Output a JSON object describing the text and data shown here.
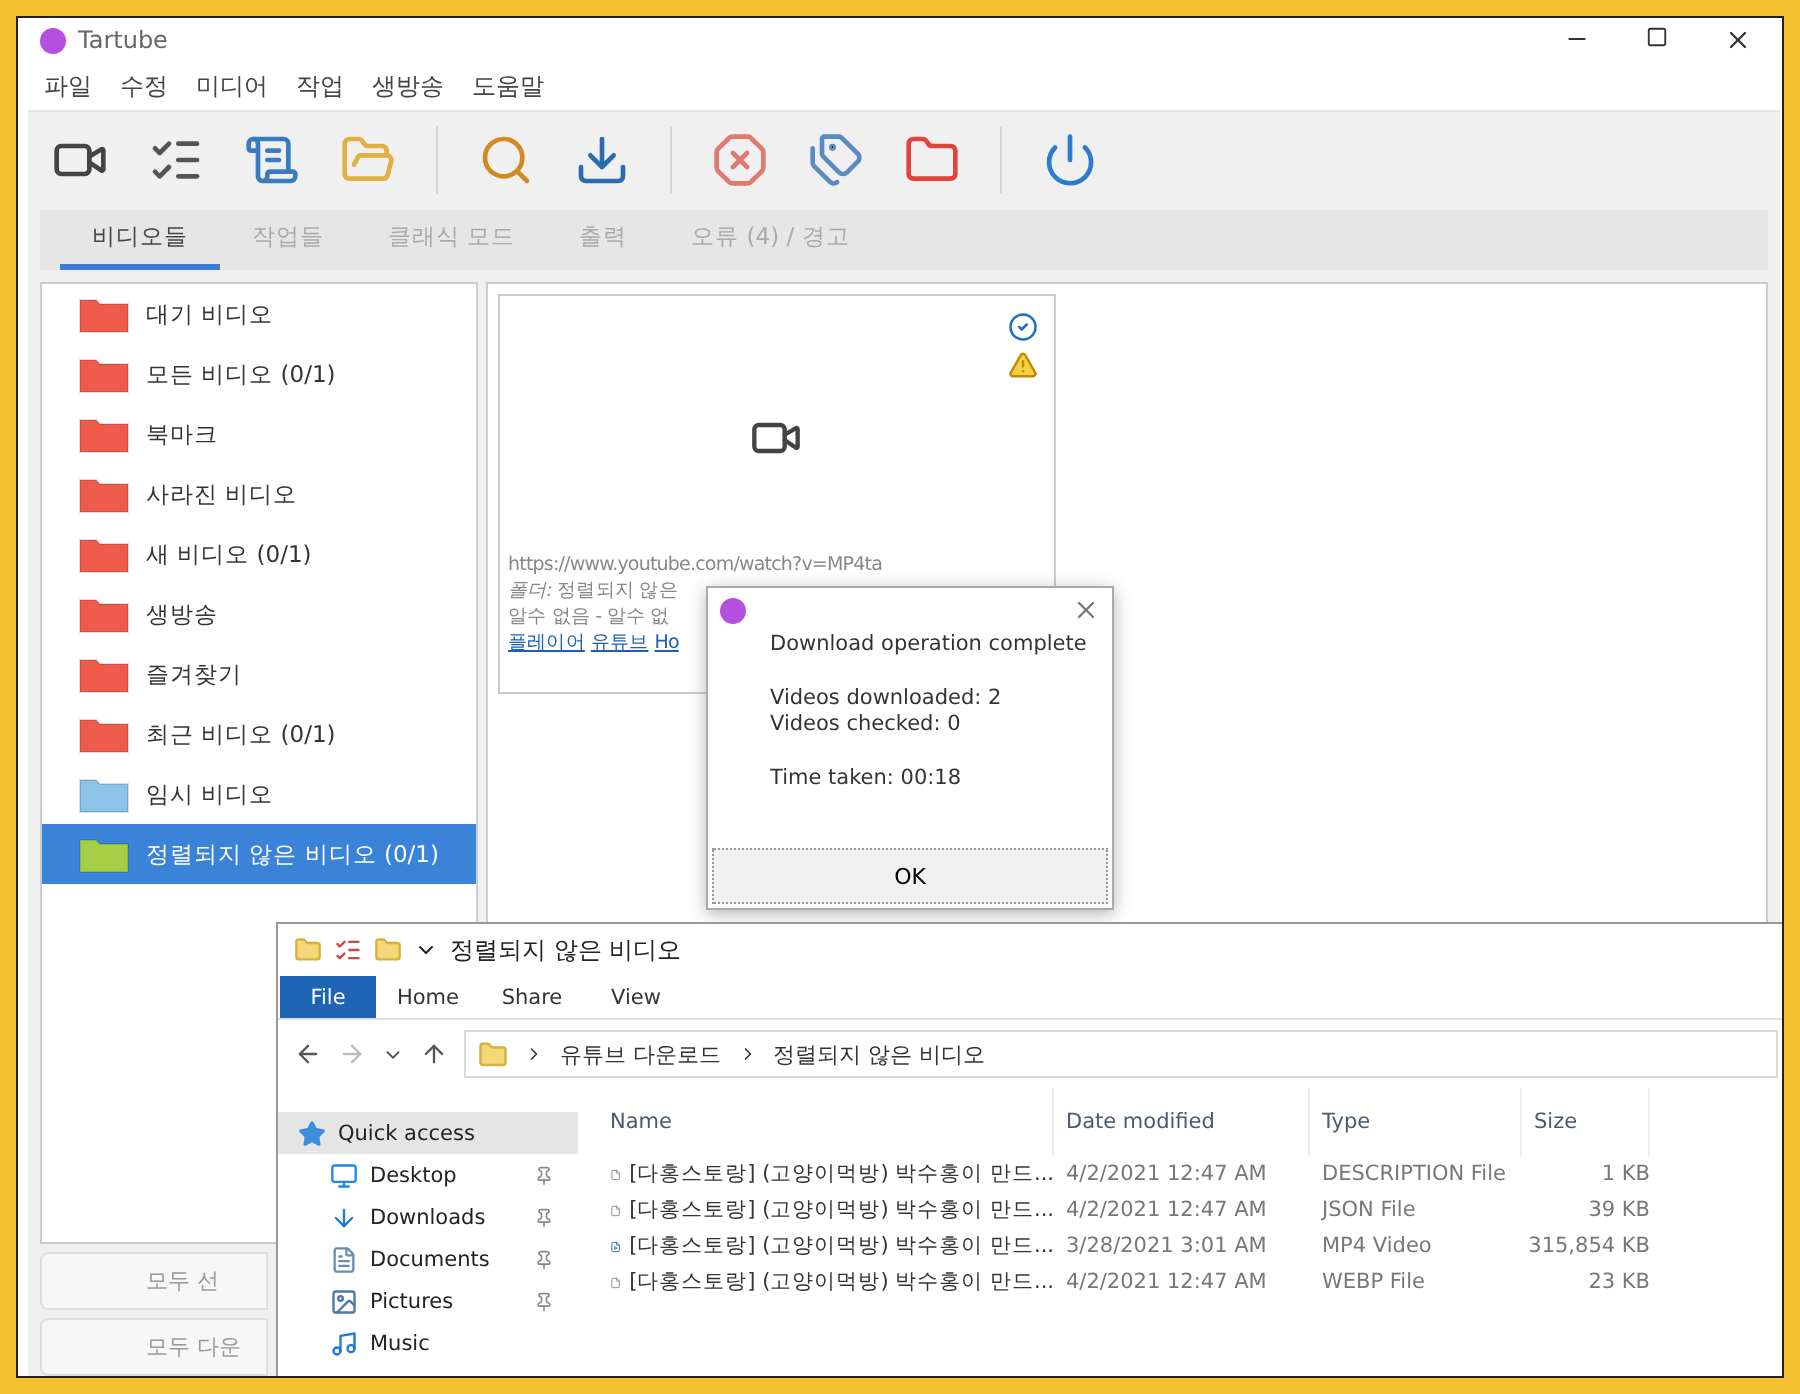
{
  "window": {
    "title": "Tartube",
    "menu": [
      "파일",
      "수정",
      "미디어",
      "작업",
      "생방송",
      "도움말"
    ]
  },
  "tabs": [
    {
      "label": "비디오들",
      "selected": true
    },
    {
      "label": "작업들",
      "selected": false
    },
    {
      "label": "클래식 모드",
      "selected": false
    },
    {
      "label": "출력",
      "selected": false
    },
    {
      "label": "오류 (4) / 경고",
      "selected": false
    }
  ],
  "folders": [
    {
      "label": "대기 비디오",
      "color": "#ee5a4c",
      "selected": false
    },
    {
      "label": "모든 비디오 (0/1)",
      "color": "#ee5a4c",
      "selected": false
    },
    {
      "label": "북마크",
      "color": "#ee5a4c",
      "selected": false
    },
    {
      "label": "사라진 비디오",
      "color": "#ee5a4c",
      "selected": false
    },
    {
      "label": "새 비디오 (0/1)",
      "color": "#ee5a4c",
      "selected": false
    },
    {
      "label": "생방송",
      "color": "#ee5a4c",
      "selected": false
    },
    {
      "label": "즐겨찾기",
      "color": "#ee5a4c",
      "selected": false
    },
    {
      "label": "최근 비디오 (0/1)",
      "color": "#ee5a4c",
      "selected": false
    },
    {
      "label": "임시 비디오",
      "color": "#8ec4ea",
      "selected": false
    },
    {
      "label": "정렬되지 않은 비디오 (0/1)",
      "color": "#a6cf48",
      "selected": true
    }
  ],
  "side_buttons": [
    "모두 선",
    "모두 다운"
  ],
  "video_card": {
    "url": "https://www.youtube.com/watch?v=MP4ta",
    "folder_label": "폴더:",
    "folder_value": "정렬되지 않은",
    "status": "알수 없음 - 알수 없",
    "links": [
      "플레이어",
      "유튜브",
      "Ho"
    ]
  },
  "dialog": {
    "heading": "Download operation complete",
    "lines": [
      "Videos downloaded: 2",
      "Videos checked: 0"
    ],
    "time": "Time taken: 00:18",
    "button": "OK"
  },
  "explorer": {
    "title": "정렬되지 않은 비디오",
    "ribbon_tabs": [
      {
        "label": "File",
        "selected": true
      },
      {
        "label": "Home",
        "selected": false
      },
      {
        "label": "Share",
        "selected": false
      },
      {
        "label": "View",
        "selected": false
      }
    ],
    "breadcrumb": [
      "유튜브 다운로드",
      "정렬되지 않은 비디오"
    ],
    "nav": [
      {
        "label": "Quick access",
        "kind": "star",
        "selected": true,
        "pinned": false
      },
      {
        "label": "Desktop",
        "kind": "desktop",
        "selected": false,
        "pinned": true
      },
      {
        "label": "Downloads",
        "kind": "download",
        "selected": false,
        "pinned": true
      },
      {
        "label": "Documents",
        "kind": "document",
        "selected": false,
        "pinned": true
      },
      {
        "label": "Pictures",
        "kind": "picture",
        "selected": false,
        "pinned": true
      },
      {
        "label": "Music",
        "kind": "music",
        "selected": false,
        "pinned": false
      }
    ],
    "columns": [
      "Name",
      "Date modified",
      "Type",
      "Size"
    ],
    "files": [
      {
        "name": "[다홍스토랑] (고양이먹방) 박수홍이 만드...",
        "date": "4/2/2021 12:47 AM",
        "type": "DESCRIPTION File",
        "size": "1 KB",
        "kind": "file"
      },
      {
        "name": "[다홍스토랑] (고양이먹방) 박수홍이 만드...",
        "date": "4/2/2021 12:47 AM",
        "type": "JSON File",
        "size": "39 KB",
        "kind": "file"
      },
      {
        "name": "[다홍스토랑] (고양이먹방) 박수홍이 만드...",
        "date": "3/28/2021 3:01 AM",
        "type": "MP4 Video",
        "size": "315,854 KB",
        "kind": "video"
      },
      {
        "name": "[다홍스토랑] (고양이먹방) 박수홍이 만드...",
        "date": "4/2/2021 12:47 AM",
        "type": "WEBP File",
        "size": "23 KB",
        "kind": "file"
      }
    ]
  }
}
